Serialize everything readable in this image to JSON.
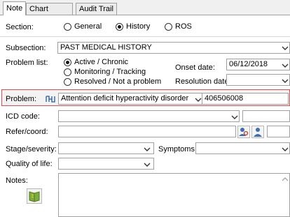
{
  "tabs": [
    "Note",
    "Chart Review",
    "Audit Trail"
  ],
  "section": {
    "label": "Section:",
    "options": [
      "General",
      "History",
      "ROS"
    ],
    "selected": "History"
  },
  "subsection": {
    "label": "Subsection:",
    "value": "PAST MEDICAL HISTORY"
  },
  "problem_list": {
    "label": "Problem list:",
    "options": [
      "Active / Chronic",
      "Monitoring / Tracking",
      "Resolved / Not a problem"
    ],
    "selected": "Active / Chronic"
  },
  "onset_date": {
    "label": "Onset date:",
    "value": "06/12/2018"
  },
  "resolution_date": {
    "label": "Resolution date:",
    "value": ""
  },
  "problem": {
    "label": "Problem:",
    "value": "Attention deficit hyperactivity disorder",
    "code": "406506008"
  },
  "icd_code": {
    "label": "ICD code:",
    "value": ""
  },
  "refer_coord": {
    "label": "Refer/coord:",
    "value": ""
  },
  "stage_severity": {
    "label": "Stage/severity:",
    "value": ""
  },
  "symptoms": {
    "label": "Symptoms:",
    "value": ""
  },
  "quality_of_life": {
    "label": "Quality of life:",
    "value": ""
  },
  "notes": {
    "label": "Notes:",
    "value": ""
  },
  "icons": {
    "problem_lookup": "link-chain-icon",
    "refer_1": "person-search-icon",
    "refer_2": "person-icon",
    "notes": "book-icon"
  },
  "colors": {
    "highlight_border": "#e04b4b"
  }
}
